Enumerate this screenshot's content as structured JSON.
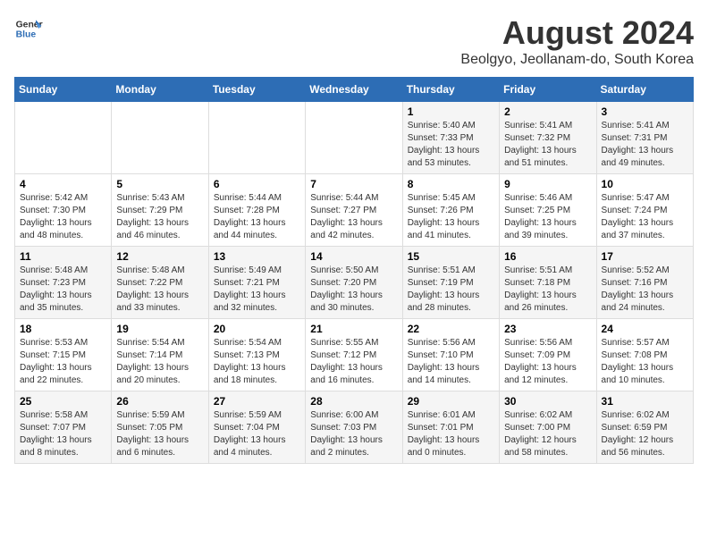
{
  "header": {
    "logo_line1": "General",
    "logo_line2": "Blue",
    "title": "August 2024",
    "subtitle": "Beolgyo, Jeollanam-do, South Korea"
  },
  "days_of_week": [
    "Sunday",
    "Monday",
    "Tuesday",
    "Wednesday",
    "Thursday",
    "Friday",
    "Saturday"
  ],
  "weeks": [
    [
      {
        "day": "",
        "content": ""
      },
      {
        "day": "",
        "content": ""
      },
      {
        "day": "",
        "content": ""
      },
      {
        "day": "",
        "content": ""
      },
      {
        "day": "1",
        "content": "Sunrise: 5:40 AM\nSunset: 7:33 PM\nDaylight: 13 hours\nand 53 minutes."
      },
      {
        "day": "2",
        "content": "Sunrise: 5:41 AM\nSunset: 7:32 PM\nDaylight: 13 hours\nand 51 minutes."
      },
      {
        "day": "3",
        "content": "Sunrise: 5:41 AM\nSunset: 7:31 PM\nDaylight: 13 hours\nand 49 minutes."
      }
    ],
    [
      {
        "day": "4",
        "content": "Sunrise: 5:42 AM\nSunset: 7:30 PM\nDaylight: 13 hours\nand 48 minutes."
      },
      {
        "day": "5",
        "content": "Sunrise: 5:43 AM\nSunset: 7:29 PM\nDaylight: 13 hours\nand 46 minutes."
      },
      {
        "day": "6",
        "content": "Sunrise: 5:44 AM\nSunset: 7:28 PM\nDaylight: 13 hours\nand 44 minutes."
      },
      {
        "day": "7",
        "content": "Sunrise: 5:44 AM\nSunset: 7:27 PM\nDaylight: 13 hours\nand 42 minutes."
      },
      {
        "day": "8",
        "content": "Sunrise: 5:45 AM\nSunset: 7:26 PM\nDaylight: 13 hours\nand 41 minutes."
      },
      {
        "day": "9",
        "content": "Sunrise: 5:46 AM\nSunset: 7:25 PM\nDaylight: 13 hours\nand 39 minutes."
      },
      {
        "day": "10",
        "content": "Sunrise: 5:47 AM\nSunset: 7:24 PM\nDaylight: 13 hours\nand 37 minutes."
      }
    ],
    [
      {
        "day": "11",
        "content": "Sunrise: 5:48 AM\nSunset: 7:23 PM\nDaylight: 13 hours\nand 35 minutes."
      },
      {
        "day": "12",
        "content": "Sunrise: 5:48 AM\nSunset: 7:22 PM\nDaylight: 13 hours\nand 33 minutes."
      },
      {
        "day": "13",
        "content": "Sunrise: 5:49 AM\nSunset: 7:21 PM\nDaylight: 13 hours\nand 32 minutes."
      },
      {
        "day": "14",
        "content": "Sunrise: 5:50 AM\nSunset: 7:20 PM\nDaylight: 13 hours\nand 30 minutes."
      },
      {
        "day": "15",
        "content": "Sunrise: 5:51 AM\nSunset: 7:19 PM\nDaylight: 13 hours\nand 28 minutes."
      },
      {
        "day": "16",
        "content": "Sunrise: 5:51 AM\nSunset: 7:18 PM\nDaylight: 13 hours\nand 26 minutes."
      },
      {
        "day": "17",
        "content": "Sunrise: 5:52 AM\nSunset: 7:16 PM\nDaylight: 13 hours\nand 24 minutes."
      }
    ],
    [
      {
        "day": "18",
        "content": "Sunrise: 5:53 AM\nSunset: 7:15 PM\nDaylight: 13 hours\nand 22 minutes."
      },
      {
        "day": "19",
        "content": "Sunrise: 5:54 AM\nSunset: 7:14 PM\nDaylight: 13 hours\nand 20 minutes."
      },
      {
        "day": "20",
        "content": "Sunrise: 5:54 AM\nSunset: 7:13 PM\nDaylight: 13 hours\nand 18 minutes."
      },
      {
        "day": "21",
        "content": "Sunrise: 5:55 AM\nSunset: 7:12 PM\nDaylight: 13 hours\nand 16 minutes."
      },
      {
        "day": "22",
        "content": "Sunrise: 5:56 AM\nSunset: 7:10 PM\nDaylight: 13 hours\nand 14 minutes."
      },
      {
        "day": "23",
        "content": "Sunrise: 5:56 AM\nSunset: 7:09 PM\nDaylight: 13 hours\nand 12 minutes."
      },
      {
        "day": "24",
        "content": "Sunrise: 5:57 AM\nSunset: 7:08 PM\nDaylight: 13 hours\nand 10 minutes."
      }
    ],
    [
      {
        "day": "25",
        "content": "Sunrise: 5:58 AM\nSunset: 7:07 PM\nDaylight: 13 hours\nand 8 minutes."
      },
      {
        "day": "26",
        "content": "Sunrise: 5:59 AM\nSunset: 7:05 PM\nDaylight: 13 hours\nand 6 minutes."
      },
      {
        "day": "27",
        "content": "Sunrise: 5:59 AM\nSunset: 7:04 PM\nDaylight: 13 hours\nand 4 minutes."
      },
      {
        "day": "28",
        "content": "Sunrise: 6:00 AM\nSunset: 7:03 PM\nDaylight: 13 hours\nand 2 minutes."
      },
      {
        "day": "29",
        "content": "Sunrise: 6:01 AM\nSunset: 7:01 PM\nDaylight: 13 hours\nand 0 minutes."
      },
      {
        "day": "30",
        "content": "Sunrise: 6:02 AM\nSunset: 7:00 PM\nDaylight: 12 hours\nand 58 minutes."
      },
      {
        "day": "31",
        "content": "Sunrise: 6:02 AM\nSunset: 6:59 PM\nDaylight: 12 hours\nand 56 minutes."
      }
    ]
  ]
}
